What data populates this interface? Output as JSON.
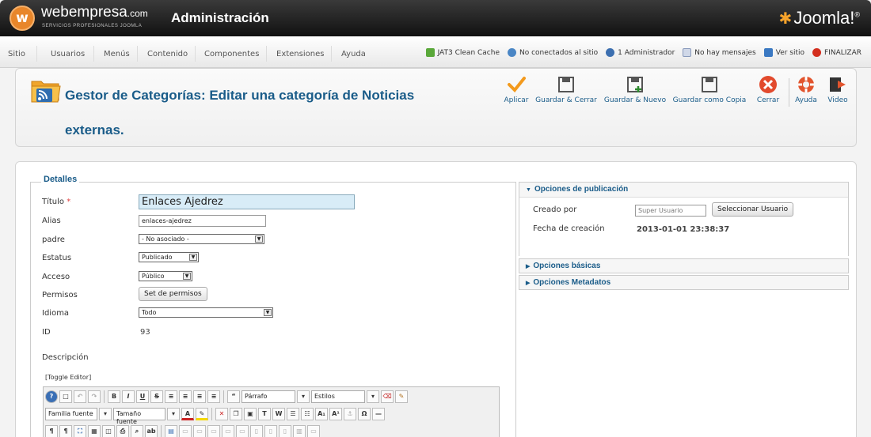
{
  "header": {
    "brand": "webempresa",
    "brand_suffix": ".com",
    "brand_sub": "SERVICIOS PROFESIONALES JOOMLA",
    "title": "Administración",
    "joomla_logo": "Joomla!"
  },
  "menu": {
    "items": [
      "Sitio",
      "Usuarios",
      "Menús",
      "Contenido",
      "Componentes",
      "Extensiones",
      "Ayuda"
    ]
  },
  "status": {
    "cache": "JAT3 Clean Cache",
    "connected": "No conectados al sitio",
    "admins": "1 Administrador",
    "messages": "No hay mensajes",
    "view_site": "Ver sitio",
    "logout": "FINALIZAR"
  },
  "toolbar": {
    "title": "Gestor de Categorías: Editar una categoría de Noticias externas.",
    "buttons": {
      "apply": "Aplicar",
      "save_close": "Guardar & Cerrar",
      "save_new": "Guardar & Nuevo",
      "save_copy": "Guardar como Copia",
      "close": "Cerrar",
      "help": "Ayuda",
      "video": "Video"
    }
  },
  "details": {
    "legend": "Detalles",
    "title_label": "Título",
    "required": "*",
    "title_value": "Enlaces Ajedrez",
    "alias_label": "Alias",
    "alias_value": "enlaces-ajedrez",
    "parent_label": "padre",
    "parent_value": "- No asociado -",
    "status_label": "Estatus",
    "status_value": "Publicado",
    "access_label": "Acceso",
    "access_value": "Público",
    "permissions_label": "Permisos",
    "permissions_button": "Set de permisos",
    "language_label": "Idioma",
    "language_value": "Todo",
    "id_label": "ID",
    "id_value": "93",
    "description_label": "Descripción",
    "toggle_editor": "[Toggle Editor]"
  },
  "editor": {
    "paragraph": "Párrafo",
    "styles": "Estilos",
    "font_family": "Familia fuente",
    "font_size": "Tamaño fuente"
  },
  "publishing": {
    "heading": "Opciones de publicación",
    "created_by_label": "Creado por",
    "created_by_value": "Super Usuario",
    "select_user": "Seleccionar Usuario",
    "created_date_label": "Fecha de creación",
    "created_date_value": "2013-01-01 23:38:37"
  },
  "basic_options": "Opciones básicas",
  "metadata_options": "Opciones Metadatos",
  "colors": {
    "accent_blue": "#1a5c89",
    "brand_orange": "#e8862a"
  }
}
